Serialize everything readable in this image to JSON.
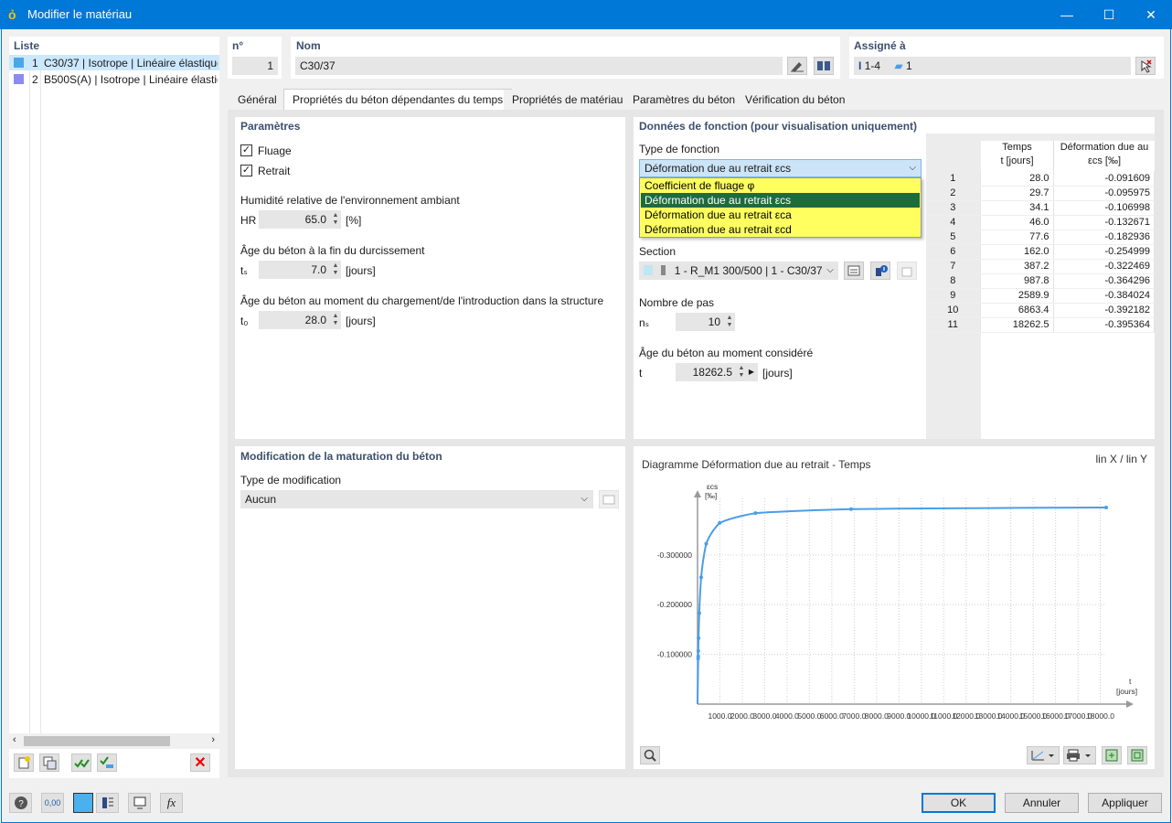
{
  "window": {
    "title": "Modifier le matériau",
    "minimize": "—",
    "maximize": "☐",
    "close": "✕"
  },
  "list": {
    "header": "Liste",
    "items": [
      {
        "num": "1",
        "label": "C30/37 | Isotrope | Linéaire élastique",
        "color": "#4aa6e8"
      },
      {
        "num": "2",
        "label": "B500S(A) | Isotrope | Linéaire élastique",
        "color": "#8b8bf0"
      }
    ]
  },
  "number": {
    "label": "n°",
    "value": "1"
  },
  "name": {
    "label": "Nom",
    "value": "C30/37"
  },
  "assigned": {
    "label": "Assigné à",
    "members": "1-4",
    "sections": "1"
  },
  "tabs": [
    {
      "label": "Général"
    },
    {
      "label": "Propriétés du béton dépendantes du temps"
    },
    {
      "label": "Propriétés de matériau"
    },
    {
      "label": "Paramètres du béton"
    },
    {
      "label": "Vérification du béton"
    }
  ],
  "params": {
    "header": "Paramètres",
    "creep": {
      "label": "Fluage",
      "checked": true
    },
    "shrinkage": {
      "label": "Retrait",
      "checked": true
    },
    "humidity": {
      "title": "Humidité relative de l'environnement ambiant",
      "symbol": "HR",
      "value": "65.0",
      "unit": "[%]"
    },
    "curing": {
      "title": "Âge du béton à la fin du durcissement",
      "symbol": "tₛ",
      "value": "7.0",
      "unit": "[jours]"
    },
    "loading": {
      "title": "Âge du béton au moment du chargement/de l'introduction dans la structure",
      "symbol": "t₀",
      "value": "28.0",
      "unit": "[jours]"
    }
  },
  "maturation": {
    "header": "Modification de la maturation du béton",
    "type_label": "Type de modification",
    "type_value": "Aucun"
  },
  "function": {
    "header": "Données de fonction (pour visualisation uniquement)",
    "type_label": "Type de fonction",
    "type_value": "Déformation due au retrait εcs",
    "options": [
      {
        "label": "Coefficient de fluage φ",
        "selected": false
      },
      {
        "label": "Déformation due au retrait εcs",
        "selected": true
      },
      {
        "label": "Déformation due au retrait εca",
        "selected": false
      },
      {
        "label": "Déformation due au retrait εcd",
        "selected": false
      }
    ],
    "section_label": "Section",
    "section_value": "1 - R_M1 300/500 | 1 - C30/37",
    "steps_label": "Nombre de pas",
    "steps_symbol": "nₛ",
    "steps_value": "10",
    "age_label": "Âge du béton au moment considéré",
    "age_symbol": "t",
    "age_value": "18262.5",
    "age_unit": "[jours]"
  },
  "table": {
    "col_time": "Temps",
    "col_time_unit": "t [jours]",
    "col_def": "Déformation due au",
    "col_def_unit": "εcs [‰]",
    "rows": [
      {
        "n": "1",
        "t": "28.0",
        "e": "-0.091609"
      },
      {
        "n": "2",
        "t": "29.7",
        "e": "-0.095975"
      },
      {
        "n": "3",
        "t": "34.1",
        "e": "-0.106998"
      },
      {
        "n": "4",
        "t": "46.0",
        "e": "-0.132671"
      },
      {
        "n": "5",
        "t": "77.6",
        "e": "-0.182936"
      },
      {
        "n": "6",
        "t": "162.0",
        "e": "-0.254999"
      },
      {
        "n": "7",
        "t": "387.2",
        "e": "-0.322469"
      },
      {
        "n": "8",
        "t": "987.8",
        "e": "-0.364296"
      },
      {
        "n": "9",
        "t": "2589.9",
        "e": "-0.384024"
      },
      {
        "n": "10",
        "t": "6863.4",
        "e": "-0.392182"
      },
      {
        "n": "11",
        "t": "18262.5",
        "e": "-0.395364"
      }
    ]
  },
  "chart_data": {
    "type": "line",
    "title": "Diagramme Déformation due au retrait - Temps",
    "scale_label": "lin X / lin Y",
    "ylabel": "εcs",
    "ylabel_unit": "[‰]",
    "xlabel": "t",
    "xlabel_unit": "[jours]",
    "yticks": [
      "-0.300000",
      "-0.200000",
      "-0.100000"
    ],
    "ytick_values": [
      -0.3,
      -0.2,
      -0.1
    ],
    "xticks": [
      "1000.0",
      "2000.0",
      "3000.0",
      "4000.0",
      "5000.0",
      "6000.0",
      "7000.0",
      "8000.0",
      "9000.0",
      "10000.0",
      "11000.0",
      "12000.0",
      "13000.0",
      "14000.0",
      "15000.0",
      "16000.0",
      "17000.0",
      "18000.0"
    ],
    "xlim": [
      0,
      18262.5
    ],
    "ylim": [
      0,
      -0.395364
    ],
    "x": [
      28.0,
      29.7,
      34.1,
      46.0,
      77.6,
      162.0,
      387.2,
      987.8,
      2589.9,
      6863.4,
      18262.5
    ],
    "y": [
      -0.091609,
      -0.095975,
      -0.106998,
      -0.132671,
      -0.182936,
      -0.254999,
      -0.322469,
      -0.364296,
      -0.384024,
      -0.392182,
      -0.395364
    ],
    "color": "#4a9ee8"
  },
  "buttons": {
    "ok": "OK",
    "cancel": "Annuler",
    "apply": "Appliquer"
  },
  "footer_icons": {
    "units": "0,00"
  }
}
